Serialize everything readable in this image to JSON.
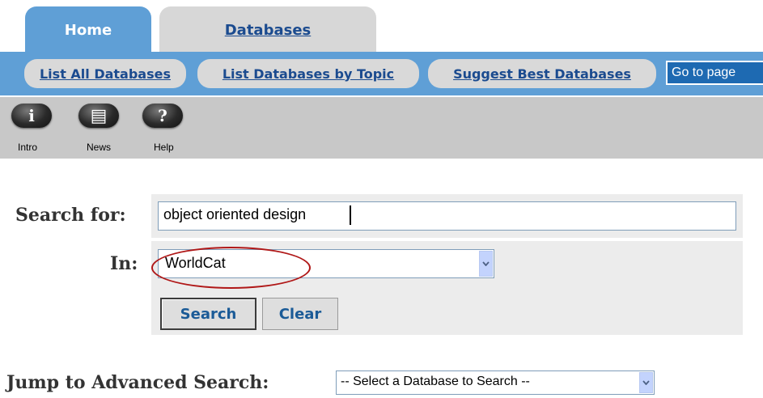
{
  "tabs": [
    {
      "label": "Home",
      "active": true
    },
    {
      "label": "Databases",
      "active": false
    }
  ],
  "nav": {
    "items": [
      "List All Databases",
      "List Databases by Topic",
      "Suggest Best Databases"
    ],
    "goto_label": "Go to page"
  },
  "toolbar": {
    "intro": {
      "glyph": "i",
      "label": "Intro",
      "icon": "info-icon"
    },
    "news": {
      "glyph": "▤",
      "label": "News",
      "icon": "newspaper-icon"
    },
    "help": {
      "glyph": "?",
      "label": "Help",
      "icon": "help-icon"
    }
  },
  "search": {
    "search_for_label": "Search for:",
    "query_value": "object oriented design",
    "in_label": "In:",
    "in_selected": "WorldCat",
    "search_button": "Search",
    "clear_button": "Clear"
  },
  "advanced": {
    "label": "Jump to Advanced Search:",
    "selected": "-- Select a Database to Search --"
  },
  "colors": {
    "nav_blue": "#5f9fd6",
    "link_blue": "#1b4b8f",
    "annotation_red": "#b01818"
  }
}
